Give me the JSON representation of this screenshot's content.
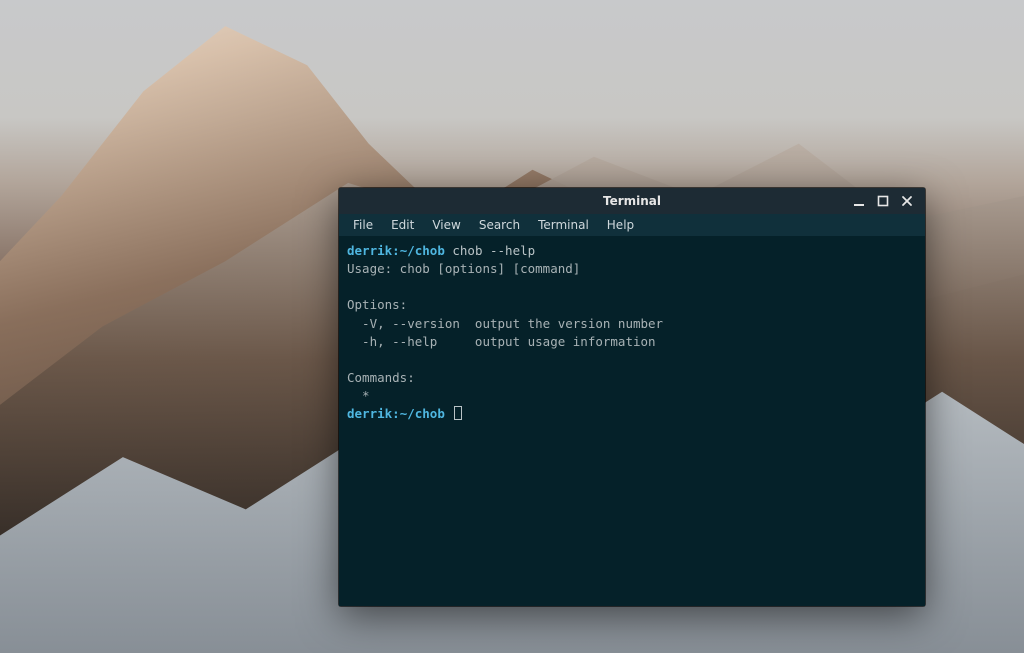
{
  "window": {
    "title": "Terminal",
    "controls": {
      "minimize": "minimize",
      "maximize": "maximize",
      "close": "close"
    }
  },
  "menubar": {
    "items": [
      "File",
      "Edit",
      "View",
      "Search",
      "Terminal",
      "Help"
    ]
  },
  "terminal": {
    "prompt1_user": "derrik:",
    "prompt1_path": "~/chob",
    "prompt1_cmd": " chob --help",
    "output_lines": [
      "Usage: chob [options] [command]",
      "",
      "Options:",
      "  -V, --version  output the version number",
      "  -h, --help     output usage information",
      "",
      "Commands:",
      "  *"
    ],
    "prompt2_user": "derrik:",
    "prompt2_path": "~/chob",
    "prompt2_cmd": " "
  },
  "colors": {
    "titlebar_bg": "#1d2b34",
    "menubar_bg": "#10303b",
    "term_bg": "#052129",
    "prompt_color": "#4fb6e0",
    "text_color": "#a8b2b5"
  }
}
